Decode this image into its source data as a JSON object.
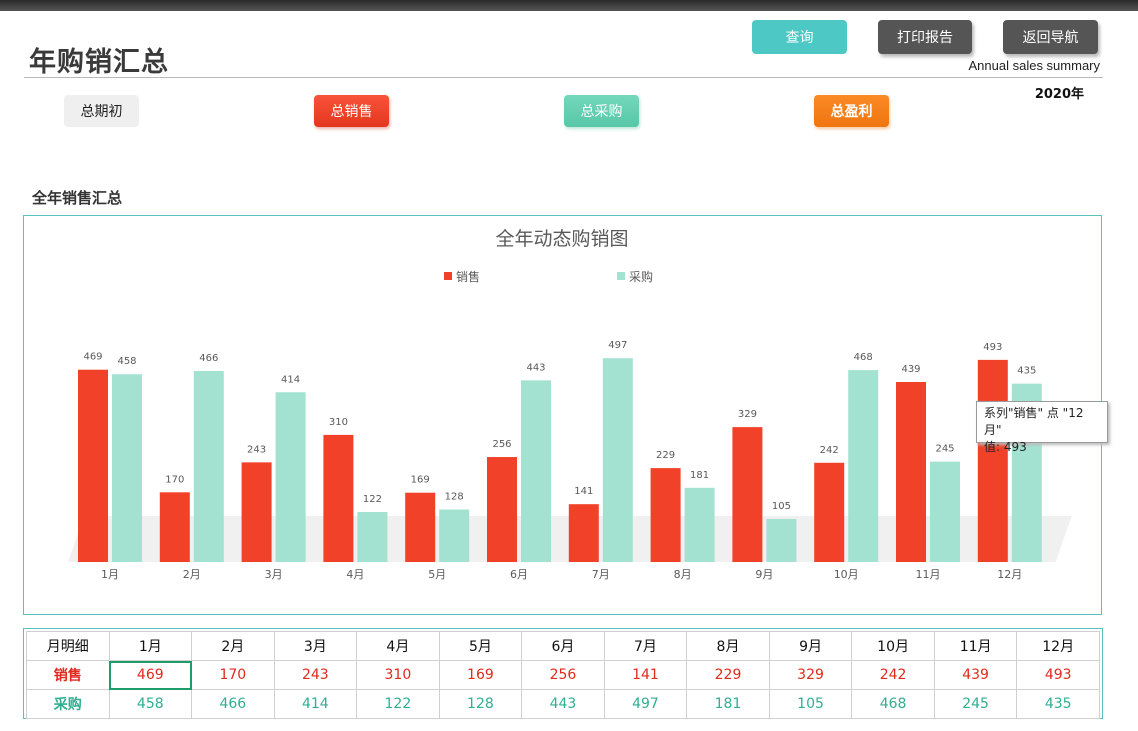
{
  "header": {
    "title": "年购销汇总",
    "subtitle_en": "Annual sales summary",
    "year": "2020年",
    "query_label": "查询",
    "print_label": "打印报告",
    "nav_label": "返回导航"
  },
  "kpis": {
    "opening": "总期初",
    "sales": "总销售",
    "purchase": "总采购",
    "profit": "总盈利"
  },
  "section_title": "全年销售汇总",
  "tooltip": {
    "line1": "系列\"销售\" 点 \"12月\"",
    "line2": "值: 493"
  },
  "colors": {
    "sales": "#f24129",
    "purchase": "#a3e2d1",
    "accent": "#4ec8c4"
  },
  "chart_data": {
    "type": "bar",
    "title": "全年动态购销图",
    "categories": [
      "1月",
      "2月",
      "3月",
      "4月",
      "5月",
      "6月",
      "7月",
      "8月",
      "9月",
      "10月",
      "11月",
      "12月"
    ],
    "series": [
      {
        "name": "销售",
        "values": [
          469,
          170,
          243,
          310,
          169,
          256,
          141,
          229,
          329,
          242,
          439,
          493
        ]
      },
      {
        "name": "采购",
        "values": [
          458,
          466,
          414,
          122,
          128,
          443,
          497,
          181,
          105,
          468,
          245,
          435
        ]
      }
    ],
    "ylim": [
      0,
      500
    ],
    "grid": false,
    "legend": "top"
  },
  "table": {
    "corner": "月明细",
    "months": [
      "1月",
      "2月",
      "3月",
      "4月",
      "5月",
      "6月",
      "7月",
      "8月",
      "9月",
      "10月",
      "11月",
      "12月"
    ],
    "sales_label": "销售",
    "purchase_label": "采购",
    "sales": [
      "469",
      "170",
      "243",
      "310",
      "169",
      "256",
      "141",
      "229",
      "329",
      "242",
      "439",
      "493"
    ],
    "purchase": [
      "458",
      "466",
      "414",
      "122",
      "128",
      "443",
      "497",
      "181",
      "105",
      "468",
      "245",
      "435"
    ]
  }
}
